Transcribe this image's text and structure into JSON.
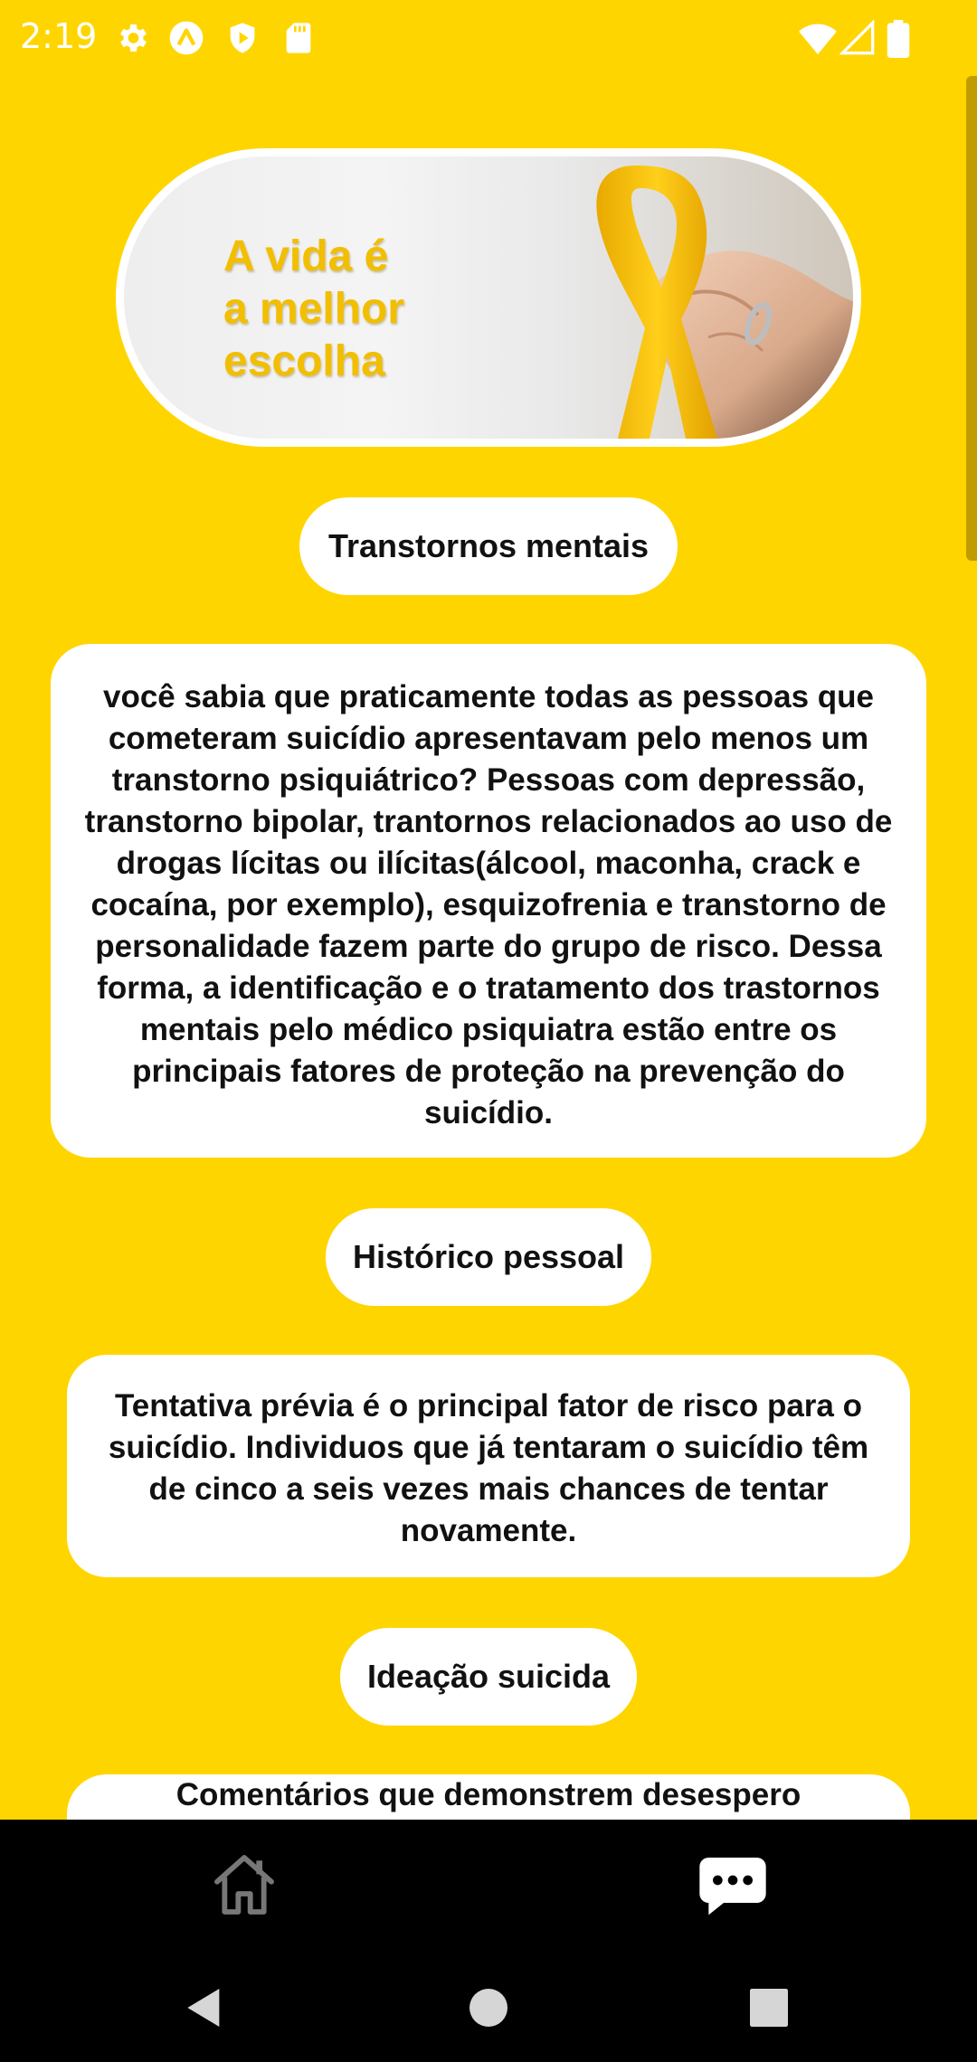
{
  "status_bar": {
    "time": "2:19",
    "icons": [
      "settings-icon",
      "notification-a-icon",
      "shield-play-icon",
      "sd-card-icon",
      "wifi-icon",
      "signal-icon",
      "battery-icon"
    ]
  },
  "banner": {
    "text": "A vida é\na melhor\nescolha",
    "text_color": "#F2BE00",
    "image": "yellow-ribbon-hand-image"
  },
  "sections": [
    {
      "title": "Transtornos mentais",
      "body": "você sabia que praticamente todas as pessoas que cometeram suicídio apresentavam pelo menos um transtorno psiquiátrico? Pessoas com depressão, transtorno bipolar, trantornos relacionados ao uso de drogas lícitas ou ilícitas(álcool, maconha, crack e cocaína, por exemplo), esquizofrenia e transtorno de personalidade fazem parte do grupo de risco. Dessa forma, a identificação e o tratamento dos trastornos mentais pelo médico psiquiatra estão entre os principais fatores de proteção na prevenção do suicídio."
    },
    {
      "title": "Histórico pessoal",
      "body": "Tentativa prévia é o principal fator de risco para o suicídio. Individuos que já tentaram o suicídio têm de cinco a seis vezes mais chances de tentar novamente."
    },
    {
      "title": "Ideação suicida",
      "body": "Comentários que demonstrem desespero"
    }
  ],
  "bottom_nav": {
    "items": [
      "home-icon",
      "chat-icon"
    ],
    "active": "chat-icon"
  },
  "system_nav": [
    "back-icon",
    "home-circle-icon",
    "recents-icon"
  ],
  "colors": {
    "background": "#FFD500",
    "card": "#FFFFFF",
    "nav": "#000000"
  }
}
